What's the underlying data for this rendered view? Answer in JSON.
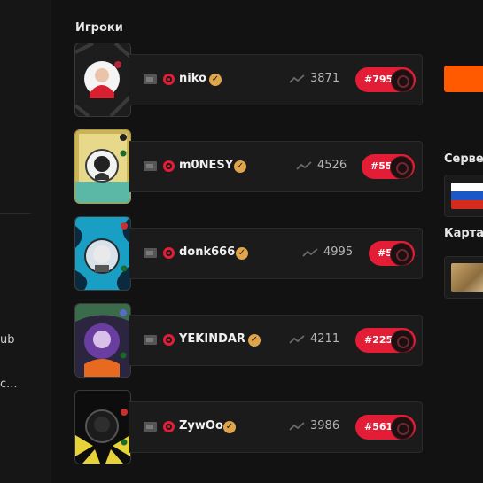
{
  "left_rail": {
    "item_1": "ub",
    "item_2": "c..."
  },
  "section_title": "Игроки",
  "players": [
    {
      "nick": "niko",
      "elo": "3871",
      "rank": "#795"
    },
    {
      "nick": "m0NESY",
      "elo": "4526",
      "rank": "#55"
    },
    {
      "nick": "donk666",
      "elo": "4995",
      "rank": "#5"
    },
    {
      "nick": "YEKINDAR",
      "elo": "4211",
      "rank": "#225"
    },
    {
      "nick": "ZywOo",
      "elo": "3986",
      "rank": "#561"
    }
  ],
  "right_panel": {
    "server_label": "Сервер",
    "map_label": "Карта"
  },
  "colors": {
    "accent_orange": "#ff5a00",
    "rank_red": "#e21d35",
    "verify_gold": "#e0a54a"
  }
}
